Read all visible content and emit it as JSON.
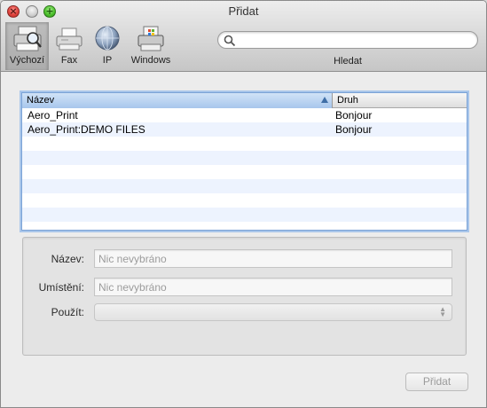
{
  "window": {
    "title": "Přidat"
  },
  "toolbar": {
    "items": [
      {
        "label": "Výchozí",
        "icon": "default-printer-icon",
        "selected": true
      },
      {
        "label": "Fax",
        "icon": "fax-icon",
        "selected": false
      },
      {
        "label": "IP",
        "icon": "globe-icon",
        "selected": false
      },
      {
        "label": "Windows",
        "icon": "windows-printer-icon",
        "selected": false
      }
    ],
    "search": {
      "value": "",
      "placeholder": "",
      "label": "Hledat"
    }
  },
  "printer_list": {
    "columns": [
      "Název",
      "Druh"
    ],
    "rows": [
      {
        "name": "Aero_Print",
        "kind": "Bonjour"
      },
      {
        "name": "Aero_Print:DEMO FILES",
        "kind": "Bonjour"
      },
      {
        "name": "",
        "kind": ""
      },
      {
        "name": "",
        "kind": ""
      },
      {
        "name": "",
        "kind": ""
      },
      {
        "name": "",
        "kind": ""
      },
      {
        "name": "",
        "kind": ""
      },
      {
        "name": "",
        "kind": ""
      }
    ]
  },
  "details": {
    "name_label": "Název:",
    "name_placeholder": "Nic nevybráno",
    "location_label": "Umístění:",
    "location_placeholder": "Nic nevybráno",
    "use_label": "Použít:",
    "use_value": ""
  },
  "buttons": {
    "add": "Přidat"
  },
  "colors": {
    "selection_header": "#a7c6ec",
    "focus_ring": "#7aa2d6",
    "alt_row": "#edf3fe"
  }
}
